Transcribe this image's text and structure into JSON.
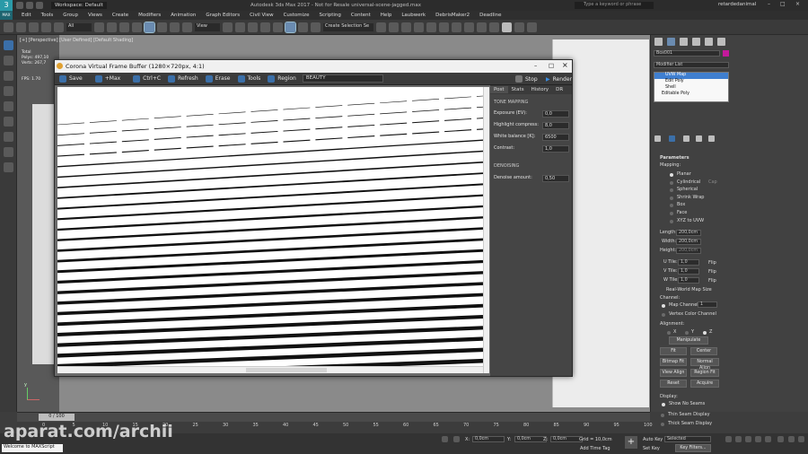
{
  "titlebar": {
    "workspace_label": "Workspace: Default",
    "title": "Autodesk 3ds Max 2017 - Not for Resale universal-scene-jagged.max",
    "search_placeholder": "Type a keyword or phrase",
    "user": "retardedanimal"
  },
  "menus": [
    "Edit",
    "Tools",
    "Group",
    "Views",
    "Create",
    "Modifiers",
    "Animation",
    "Graph Editors",
    "Civil View",
    "Customize",
    "Scripting",
    "Content",
    "Help",
    "Laubwerk",
    "DebrisMaker2",
    "Deadline"
  ],
  "toolbar": {
    "selection_filter": "All",
    "ref_coord": "View",
    "named_selection_placeholder": "Create Selection Se"
  },
  "viewport": {
    "label": "[+] [Perspective] [User Defined] [Default Shading]",
    "stats": [
      "Total",
      "Polys: 497,10",
      "Verts: 267,7",
      "FPS: 1.70"
    ],
    "axis": "y"
  },
  "vfb": {
    "title": "Corona Virtual Frame Buffer (1280×720px, 4:1)",
    "tools": {
      "save": "Save",
      "max": "+Max",
      "copy": "Ctrl+C",
      "refresh": "Refresh",
      "erase": "Erase",
      "tools": "Tools",
      "region": "Region",
      "channel": "BEAUTY",
      "stop": "Stop",
      "render": "Render"
    },
    "tabs": [
      "Post",
      "Stats",
      "History",
      "DR"
    ],
    "tone_mapping": {
      "header": "TONE MAPPING",
      "rows": [
        {
          "label": "Exposure (EV):",
          "value": "0,0"
        },
        {
          "label": "Highlight compress:",
          "value": "8,0"
        },
        {
          "label": "White balance [K]:",
          "value": "6500"
        },
        {
          "label": "Contrast:",
          "value": "1,0"
        }
      ]
    },
    "denoising": {
      "header": "DENOISING",
      "label": "Denoise amount:",
      "value": "0,50"
    }
  },
  "command_panel": {
    "object_name": "Box001",
    "object_color": "#c4199b",
    "modifier_list": "Modifier List",
    "stack": [
      "UVW Map",
      "Edit Poly",
      "Shell",
      "Editable Poly"
    ],
    "parameters_header": "Parameters",
    "mapping_label": "Mapping:",
    "mapping_options": [
      "Planar",
      "Cylindrical",
      "Spherical",
      "Shrink Wrap",
      "Box",
      "Face",
      "XYZ to UVW"
    ],
    "cap_label": "Cap",
    "length_label": "Length:",
    "length_value": "200,0cm",
    "width_label": "Width:",
    "width_value": "200,0cm",
    "height_label": "Height:",
    "height_value": "200,0cm",
    "utile_label": "U Tile:",
    "utile_value": "1,0",
    "vtile_label": "V Tile:",
    "vtile_value": "1,0",
    "wtile_label": "W Tile:",
    "wtile_value": "1,0",
    "flip_label": "Flip",
    "real_world": "Real-World Map Size",
    "channel_label": "Channel:",
    "map_channel": "Map Channel:",
    "map_channel_value": "1",
    "vertex_color": "Vertex Color Channel",
    "alignment_label": "Alignment:",
    "axes": [
      "X",
      "Y",
      "Z"
    ],
    "manipulate": "Manipulate",
    "fit": "Fit",
    "center": "Center",
    "bitmap_fit": "Bitmap Fit",
    "normal_align": "Normal Align",
    "view_align": "View Align",
    "region_fit": "Region Fit",
    "reset": "Reset",
    "acquire": "Acquire",
    "display_label": "Display:",
    "display_options": [
      "Show No Seams",
      "Thin Seam Display",
      "Thick Seam Display"
    ]
  },
  "timeline": {
    "frame": "0 / 100",
    "ticks": [
      "0",
      "5",
      "10",
      "15",
      "20",
      "25",
      "30",
      "35",
      "40",
      "45",
      "50",
      "55",
      "60",
      "65",
      "70",
      "75",
      "80",
      "85",
      "90",
      "95",
      "100"
    ]
  },
  "status": {
    "maxscript": "Welcome to MAXScript",
    "x_label": "X:",
    "x_value": "0,0cm",
    "y_label": "Y:",
    "y_value": "0,0cm",
    "z_label": "Z:",
    "z_value": "0,0cm",
    "grid": "Grid = 10,0cm",
    "add_time_tag": "Add Time Tag",
    "auto_key": "Auto Key",
    "set_key": "Set Key",
    "selected": "Selected",
    "key_filters": "Key Filters..."
  },
  "watermark": "aparat.com/archii"
}
